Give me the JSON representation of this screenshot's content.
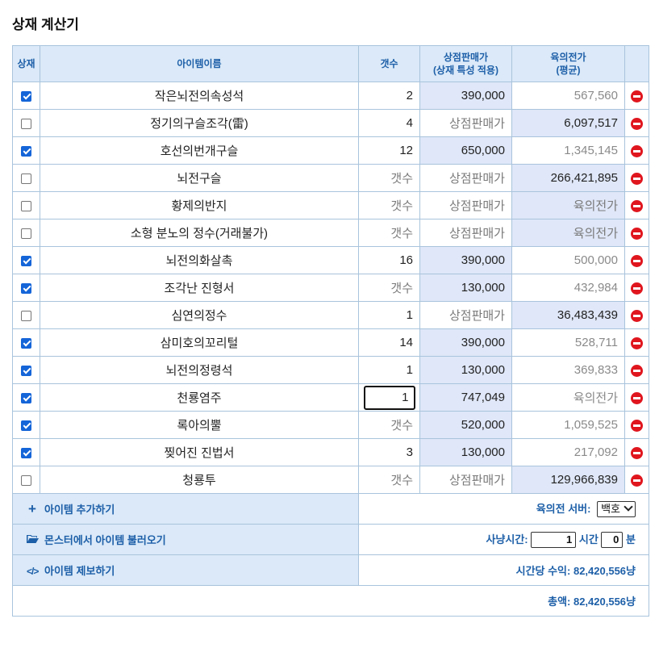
{
  "page": {
    "title": "상재 계산기"
  },
  "header": {
    "col_check": "상재",
    "col_name": "아이템이름",
    "col_count": "갯수",
    "col_shop_line1": "상점판매가",
    "col_shop_line2": "(상재 특성 적용)",
    "col_market_line1": "육의전가",
    "col_market_line2": "(평균)"
  },
  "items": [
    {
      "checked": true,
      "name": "작은뇌전의속성석",
      "count": "2",
      "count_ph": false,
      "shop": "390,000",
      "shop_ph": false,
      "market": "567,560",
      "market_state": "inactive"
    },
    {
      "checked": false,
      "name": "정기의구슬조각(雷)",
      "count": "4",
      "count_ph": false,
      "shop": "상점판매가",
      "shop_ph": true,
      "market": "6,097,517",
      "market_state": "active"
    },
    {
      "checked": true,
      "name": "호선의번개구슬",
      "count": "12",
      "count_ph": false,
      "shop": "650,000",
      "shop_ph": false,
      "market": "1,345,145",
      "market_state": "inactive"
    },
    {
      "checked": false,
      "name": "뇌전구슬",
      "count": "갯수",
      "count_ph": true,
      "shop": "상점판매가",
      "shop_ph": true,
      "market": "266,421,895",
      "market_state": "active"
    },
    {
      "checked": false,
      "name": "황제의반지",
      "count": "갯수",
      "count_ph": true,
      "shop": "상점판매가",
      "shop_ph": true,
      "market": "육의전가",
      "market_state": "placeholder"
    },
    {
      "checked": false,
      "name": "소형 분노의 정수(거래불가)",
      "count": "갯수",
      "count_ph": true,
      "shop": "상점판매가",
      "shop_ph": true,
      "market": "육의전가",
      "market_state": "placeholder"
    },
    {
      "checked": true,
      "name": "뇌전의화살촉",
      "count": "16",
      "count_ph": false,
      "shop": "390,000",
      "shop_ph": false,
      "market": "500,000",
      "market_state": "inactive"
    },
    {
      "checked": true,
      "name": "조각난 진형서",
      "count": "갯수",
      "count_ph": true,
      "shop": "130,000",
      "shop_ph": false,
      "market": "432,984",
      "market_state": "inactive"
    },
    {
      "checked": false,
      "name": "심연의정수",
      "count": "1",
      "count_ph": false,
      "shop": "상점판매가",
      "shop_ph": true,
      "market": "36,483,439",
      "market_state": "active"
    },
    {
      "checked": true,
      "name": "삼미호의꼬리털",
      "count": "14",
      "count_ph": false,
      "shop": "390,000",
      "shop_ph": false,
      "market": "528,711",
      "market_state": "inactive"
    },
    {
      "checked": true,
      "name": "뇌전의정령석",
      "count": "1",
      "count_ph": false,
      "shop": "130,000",
      "shop_ph": false,
      "market": "369,833",
      "market_state": "inactive"
    },
    {
      "checked": true,
      "name": "천룡염주",
      "count": "1",
      "count_ph": false,
      "count_focused": true,
      "shop": "747,049",
      "shop_ph": false,
      "market": "육의전가",
      "market_state": "inactive"
    },
    {
      "checked": true,
      "name": "록아의뿔",
      "count": "갯수",
      "count_ph": true,
      "shop": "520,000",
      "shop_ph": false,
      "market": "1,059,525",
      "market_state": "inactive"
    },
    {
      "checked": true,
      "name": "찢어진 진법서",
      "count": "3",
      "count_ph": false,
      "shop": "130,000",
      "shop_ph": false,
      "market": "217,092",
      "market_state": "inactive"
    },
    {
      "checked": false,
      "name": "청룡투",
      "count": "갯수",
      "count_ph": true,
      "shop": "상점판매가",
      "shop_ph": true,
      "market": "129,966,839",
      "market_state": "active"
    }
  ],
  "actions": {
    "add_item": "아이템 추가하기",
    "load_from_monster": "몬스터에서 아이템 불러오기",
    "report_item": "아이템 제보하기"
  },
  "server": {
    "label": "육의전 서버:",
    "selected": "백호"
  },
  "hunt_time": {
    "label": "사냥시간:",
    "hours": "1",
    "hours_unit": "시간",
    "minutes": "0",
    "minutes_unit": "분"
  },
  "per_hour": {
    "label": "시간당 수익: 82,420,556냥"
  },
  "total": {
    "label": "총액: 82,420,556냥"
  },
  "colors": {
    "accent": "#1d5fa8",
    "header_bg": "#dbe9f8",
    "price_bg": "#dfe7f8",
    "checkbox": "#1565d8",
    "delete": "#e0161e"
  }
}
